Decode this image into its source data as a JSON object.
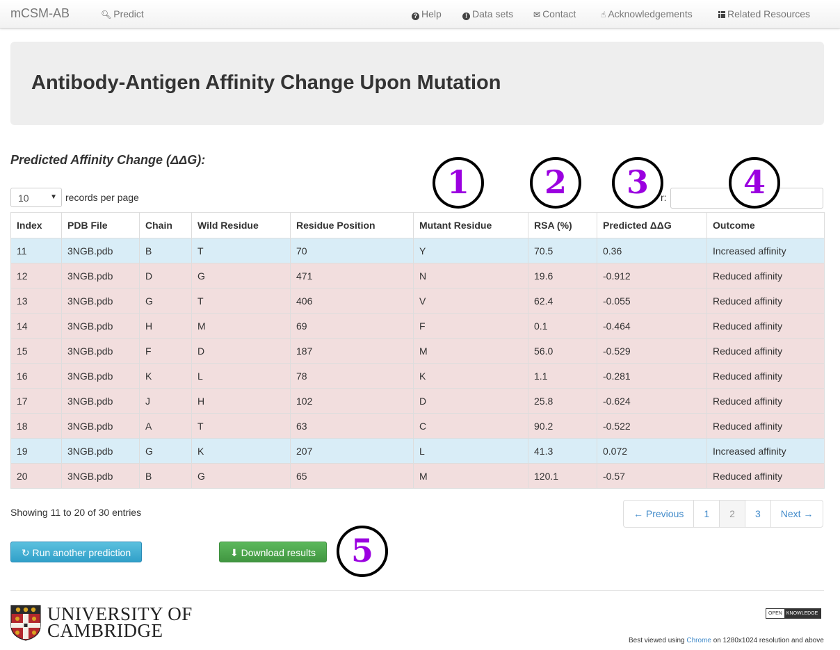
{
  "nav": {
    "brand": "mCSM-AB",
    "predict": "Predict",
    "help": "Help",
    "datasets": "Data sets",
    "contact": "Contact",
    "acknowledgements": "Acknowledgements",
    "related": "Related Resources"
  },
  "page": {
    "title": "Antibody-Antigen Affinity Change Upon Mutation",
    "section_title": "Predicted Affinity Change (ΔΔG):"
  },
  "controls": {
    "page_length": "10",
    "records_text": "records per page",
    "filter_label": "r:",
    "filter_value": ""
  },
  "table": {
    "headers": [
      "Index",
      "PDB File",
      "Chain",
      "Wild Residue",
      "Residue Position",
      "Mutant Residue",
      "RSA (%)",
      "Predicted ΔΔG",
      "Outcome"
    ],
    "rows": [
      {
        "type": "increased",
        "cells": [
          "11",
          "3NGB.pdb",
          "B",
          "T",
          "70",
          "Y",
          "70.5",
          "0.36",
          "Increased affinity"
        ]
      },
      {
        "type": "reduced",
        "cells": [
          "12",
          "3NGB.pdb",
          "D",
          "G",
          "471",
          "N",
          "19.6",
          "-0.912",
          "Reduced affinity"
        ]
      },
      {
        "type": "reduced",
        "cells": [
          "13",
          "3NGB.pdb",
          "G",
          "T",
          "406",
          "V",
          "62.4",
          "-0.055",
          "Reduced affinity"
        ]
      },
      {
        "type": "reduced",
        "cells": [
          "14",
          "3NGB.pdb",
          "H",
          "M",
          "69",
          "F",
          "0.1",
          "-0.464",
          "Reduced affinity"
        ]
      },
      {
        "type": "reduced",
        "cells": [
          "15",
          "3NGB.pdb",
          "F",
          "D",
          "187",
          "M",
          "56.0",
          "-0.529",
          "Reduced affinity"
        ]
      },
      {
        "type": "reduced",
        "cells": [
          "16",
          "3NGB.pdb",
          "K",
          "L",
          "78",
          "K",
          "1.1",
          "-0.281",
          "Reduced affinity"
        ]
      },
      {
        "type": "reduced",
        "cells": [
          "17",
          "3NGB.pdb",
          "J",
          "H",
          "102",
          "D",
          "25.8",
          "-0.624",
          "Reduced affinity"
        ]
      },
      {
        "type": "reduced",
        "cells": [
          "18",
          "3NGB.pdb",
          "A",
          "T",
          "63",
          "C",
          "90.2",
          "-0.522",
          "Reduced affinity"
        ]
      },
      {
        "type": "increased",
        "cells": [
          "19",
          "3NGB.pdb",
          "G",
          "K",
          "207",
          "L",
          "41.3",
          "0.072",
          "Increased affinity"
        ]
      },
      {
        "type": "reduced",
        "cells": [
          "20",
          "3NGB.pdb",
          "B",
          "G",
          "65",
          "M",
          "120.1",
          "-0.57",
          "Reduced affinity"
        ]
      }
    ]
  },
  "info": "Showing 11 to 20 of 30 entries",
  "pagination": {
    "previous": "← Previous",
    "pages": [
      "1",
      "2",
      "3"
    ],
    "active": "2",
    "next": "Next →"
  },
  "buttons": {
    "run_another": "Run another prediction",
    "download": "Download results"
  },
  "annotations": [
    "1",
    "2",
    "3",
    "4",
    "5"
  ],
  "footer": {
    "university_line1": "UNIVERSITY OF",
    "university_line2": "CAMBRIDGE",
    "ok_left": "OPEN",
    "ok_right": "KNOWLEDGE",
    "best_viewed_prefix": "Best viewed using ",
    "best_viewed_link": "Chrome",
    "best_viewed_suffix": " on 1280x1024 resolution and above"
  },
  "colors": {
    "increased_row": "#d9edf7",
    "reduced_row": "#f2dede",
    "annotation_digit": "#9b00e0",
    "link": "#428bca"
  }
}
